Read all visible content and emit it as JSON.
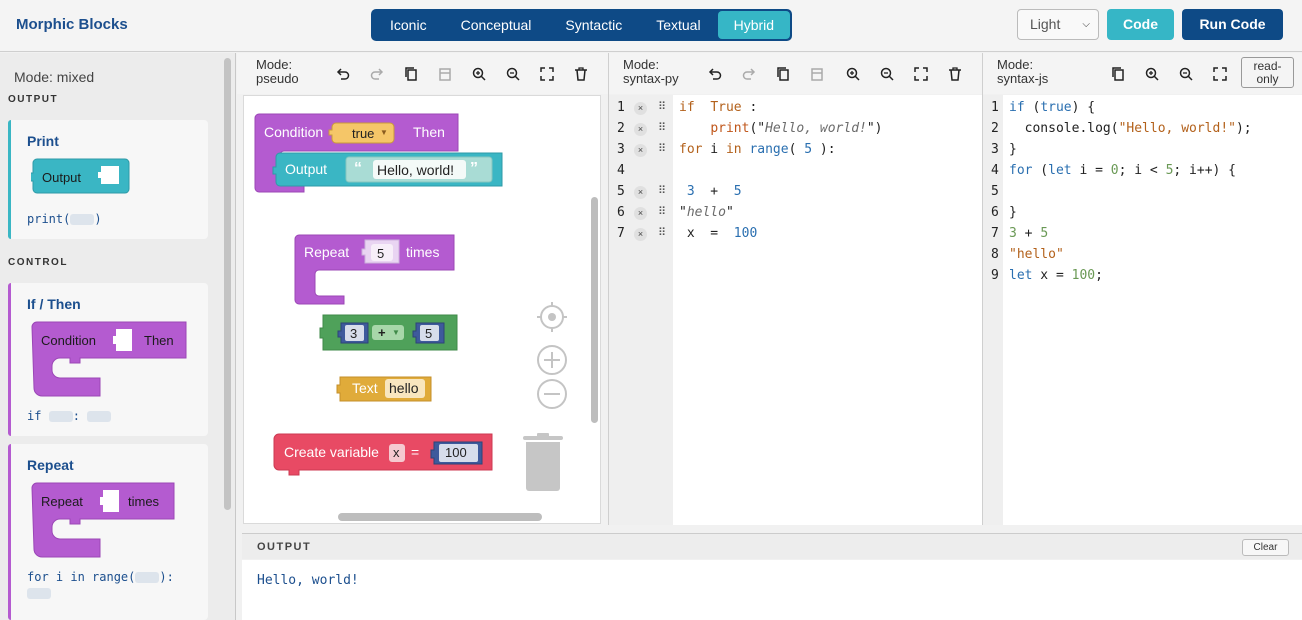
{
  "app": {
    "title": "Morphic Blocks"
  },
  "modes": [
    "Iconic",
    "Conceptual",
    "Syntactic",
    "Textual",
    "Hybrid"
  ],
  "active_mode": "Hybrid",
  "theme": {
    "selected": "Light"
  },
  "buttons": {
    "code": "Code",
    "run": "Run Code"
  },
  "sidebar": {
    "mode_label": "Mode: mixed",
    "sections": [
      {
        "title": "OUTPUT",
        "cards": [
          {
            "title": "Print",
            "block_label": "Output",
            "code_prefix": "print(",
            "code_suffix": ")"
          }
        ]
      },
      {
        "title": "CONTROL",
        "cards": [
          {
            "title": "If / Then",
            "block_label": "Condition",
            "block_label_2": "Then",
            "code_prefix": "if",
            "code_mid": ":"
          },
          {
            "title": "Repeat",
            "block_label": "Repeat",
            "block_label_2": "times",
            "code_prefix": "for i in range(",
            "code_suffix": "):"
          }
        ]
      }
    ]
  },
  "panels": {
    "pseudo": {
      "mode_line1": "Mode:",
      "mode_line2": "pseudo"
    },
    "python": {
      "mode_line1": "Mode:",
      "mode_line2": "syntax-py"
    },
    "js": {
      "mode_line1": "Mode:",
      "mode_line2": "syntax-js",
      "readonly_line1": "read-",
      "readonly_line2": "only"
    }
  },
  "workspace": {
    "condition_block": {
      "label": "Condition",
      "value": "true",
      "then": "Then"
    },
    "output_block": {
      "label": "Output",
      "open_quote": "“",
      "text": "Hello, world!",
      "close_quote": "”"
    },
    "repeat_block": {
      "label": "Repeat",
      "count": "5",
      "times": "times"
    },
    "math_block": {
      "left": "3",
      "op": "+",
      "right": "5"
    },
    "text_block": {
      "label": "Text",
      "value": "hello"
    },
    "variable_block": {
      "label": "Create variable",
      "name": "x",
      "eq": "=",
      "value": "100"
    }
  },
  "python_code": {
    "line_numbers": [
      "1",
      "2",
      "3",
      "4",
      "5",
      "6",
      "7"
    ],
    "lines": [
      "if  True :",
      "    print(\"Hello, world!\")",
      "for i in range( 5 ):",
      "",
      " 3  +  5",
      "\"hello\"",
      " x  =  100"
    ]
  },
  "js_code": {
    "line_numbers": [
      "1",
      "2",
      "3",
      "4",
      "5",
      "6",
      "7",
      "8",
      "9"
    ],
    "lines": [
      "if (true) {",
      "  console.log(\"Hello, world!\");",
      "}",
      "for (let i = 0; i < 5; i++) {",
      "",
      "}",
      "3 + 5",
      "\"hello\"",
      "let x = 100;"
    ]
  },
  "output": {
    "title": "OUTPUT",
    "clear": "Clear",
    "lines": [
      "Hello, world!"
    ]
  },
  "colors": {
    "brand": "#1c4f8e",
    "nav": "#0e4a86",
    "accent": "#36b6c6",
    "output_block": "#3ab6c4",
    "control_block": "#b45bd0",
    "math_block": "#4fa15a",
    "text_block": "#e0ab3a",
    "variable_block": "#e84a64"
  }
}
